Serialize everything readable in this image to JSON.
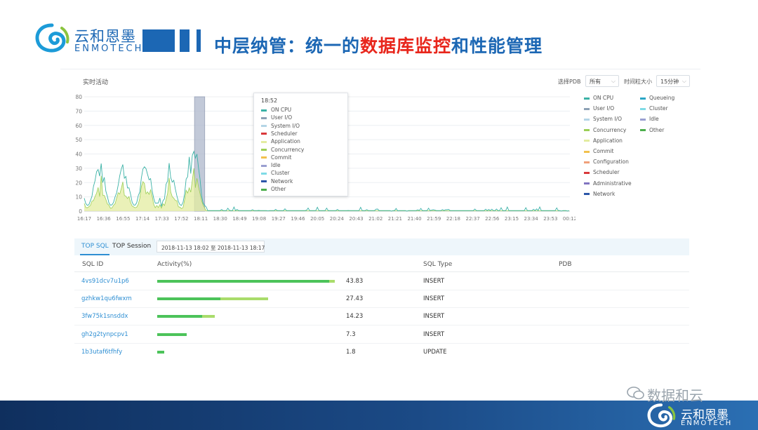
{
  "brand": {
    "name_cn": "云和恩墨",
    "name_en": "ENMOTECH",
    "color": "#1c67b4"
  },
  "slide_title": {
    "part1": "中层纳管：统一的",
    "highlight": "数据库监控",
    "part2": "和性能管理",
    "highlight_color": "#e8261c"
  },
  "panel": {
    "title": "实时活动",
    "pdb_label": "选择PDB",
    "pdb_value": "所有",
    "granularity_label": "时间粒大小",
    "granularity_value": "15分钟"
  },
  "chart_data": {
    "type": "area",
    "xlabel": "",
    "ylabel": "",
    "ylim": [
      0,
      60
    ],
    "yticks": [
      0,
      10,
      20,
      30,
      40,
      50,
      60,
      70,
      80
    ],
    "x_ticks": [
      "16:17",
      "16:36",
      "16:55",
      "17:14",
      "17:33",
      "17:52",
      "18:11",
      "18:30",
      "18:49",
      "19:08",
      "19:27",
      "19:46",
      "20:05",
      "20:24",
      "20:43",
      "21:02",
      "21:21",
      "21:40",
      "21:59",
      "22:18",
      "22:37",
      "22:56",
      "23:15",
      "23:34",
      "23:53",
      "00:12"
    ],
    "highlight_range": [
      "18:05",
      "18:15"
    ],
    "series": [
      {
        "name": "ON CPU",
        "color": "#3bb2a6",
        "description_values": "spikes 15-70 between 16:17 and 18:15, near 0 after"
      },
      {
        "name": "Application",
        "color": "#dfe8a6"
      },
      {
        "name": "Other",
        "color": "#4cae4c"
      }
    ],
    "legend": {
      "placement": "right",
      "col1": [
        {
          "name": "ON CPU",
          "color": "#3bb2a6"
        },
        {
          "name": "User I/O",
          "color": "#8da1b5"
        },
        {
          "name": "System I/O",
          "color": "#b4d5e6"
        },
        {
          "name": "Concurrency",
          "color": "#9bcf56"
        },
        {
          "name": "Application",
          "color": "#e3eca0"
        },
        {
          "name": "Commit",
          "color": "#f2c14e"
        },
        {
          "name": "Configuration",
          "color": "#f0a07a"
        },
        {
          "name": "Scheduler",
          "color": "#d9383a"
        },
        {
          "name": "Administrative",
          "color": "#8074c0"
        },
        {
          "name": "Network",
          "color": "#2c56a8"
        }
      ],
      "col2": [
        {
          "name": "Queueing",
          "color": "#2aa6c6"
        },
        {
          "name": "Cluster",
          "color": "#7fdbe6"
        },
        {
          "name": "Idle",
          "color": "#9a9fd1"
        },
        {
          "name": "Other",
          "color": "#4cae4c"
        }
      ]
    },
    "tooltip": {
      "time": "18:52",
      "items": [
        {
          "name": "ON CPU",
          "color": "#3bb2a6"
        },
        {
          "name": "User I/O",
          "color": "#8da1b5"
        },
        {
          "name": "System I/O",
          "color": "#b4d5e6"
        },
        {
          "name": "Scheduler",
          "color": "#d9383a"
        },
        {
          "name": "Application",
          "color": "#e3eca0"
        },
        {
          "name": "Concurrency",
          "color": "#9bcf56"
        },
        {
          "name": "Commit",
          "color": "#f2c14e"
        },
        {
          "name": "Idle",
          "color": "#9a9fd1"
        },
        {
          "name": "Cluster",
          "color": "#7fdbe6"
        },
        {
          "name": "Network",
          "color": "#2c56a8"
        },
        {
          "name": "Other",
          "color": "#4cae4c"
        }
      ]
    }
  },
  "tabs": {
    "top_sql": "TOP SQL",
    "top_session": "TOP Session",
    "range": "2018-11-13 18:02 至 2018-11-13 18:17"
  },
  "table": {
    "headers": {
      "sql_id": "SQL ID",
      "activity": "Activity(%)",
      "sql_type": "SQL Type",
      "pdb": "PDB"
    },
    "rows": [
      {
        "sql_id": "4vs91dcv7u1p6",
        "activity": "43.83",
        "activity_value": 43.83,
        "dark_share": 0.97,
        "sql_type": "INSERT"
      },
      {
        "sql_id": "gzhkw1qu6fwxm",
        "activity": "27.43",
        "activity_value": 27.43,
        "dark_share": 0.57,
        "sql_type": "INSERT"
      },
      {
        "sql_id": "3fw75k1snsddx",
        "activity": "14.23",
        "activity_value": 14.23,
        "dark_share": 0.78,
        "sql_type": "INSERT"
      },
      {
        "sql_id": "gh2g2tynpcpv1",
        "activity": "7.3",
        "activity_value": 7.3,
        "dark_share": 1.0,
        "sql_type": "INSERT"
      },
      {
        "sql_id": "1b3utaf6tfhfy",
        "activity": "1.8",
        "activity_value": 1.8,
        "dark_share": 1.0,
        "sql_type": "UPDATE"
      }
    ]
  },
  "watermark": "数据和云"
}
